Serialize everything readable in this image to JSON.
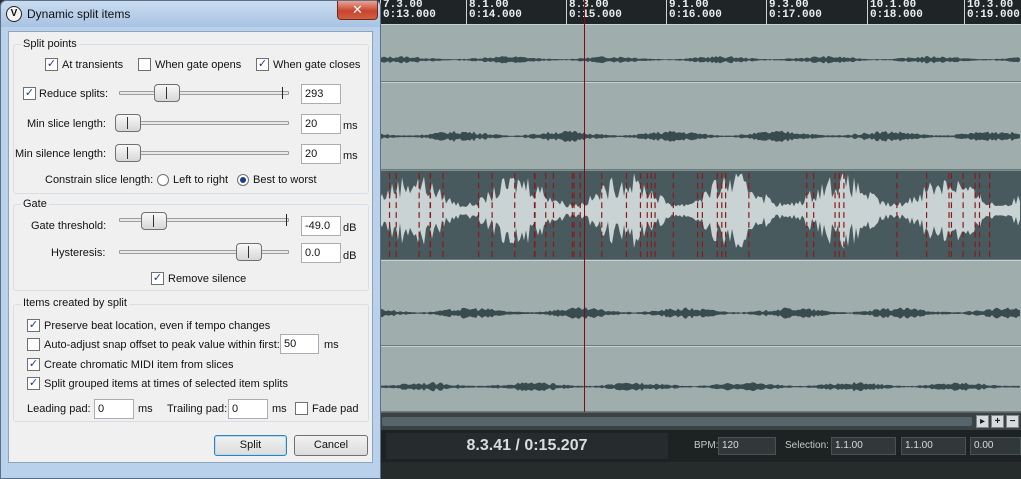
{
  "dialog": {
    "title": "Dynamic split items",
    "close_symbol": "✕",
    "app_icon_symbol": "V",
    "split_points": {
      "group_label": "Split points",
      "at_transients": {
        "label": "At transients",
        "checked": true
      },
      "when_gate_opens": {
        "label": "When gate opens",
        "checked": false
      },
      "when_gate_closes": {
        "label": "When gate closes",
        "checked": true
      },
      "reduce_splits": {
        "label": "Reduce splits:",
        "checked": true,
        "value": "293"
      },
      "min_slice_length": {
        "label": "Min slice length:",
        "value": "20",
        "unit": "ms"
      },
      "min_silence_length": {
        "label": "Min silence length:",
        "value": "20",
        "unit": "ms"
      },
      "constrain": {
        "label": "Constrain slice length:",
        "options": [
          {
            "label": "Left to right",
            "selected": false
          },
          {
            "label": "Best to worst",
            "selected": true
          }
        ]
      }
    },
    "gate": {
      "group_label": "Gate",
      "threshold": {
        "label": "Gate threshold:",
        "value": "-49.0",
        "unit": "dB"
      },
      "hysteresis": {
        "label": "Hysteresis:",
        "value": "0.0",
        "unit": "dB"
      },
      "remove_silence": {
        "label": "Remove silence",
        "checked": true
      }
    },
    "items": {
      "group_label": "Items created by split",
      "preserve_beat": {
        "label": "Preserve beat location, even if tempo changes",
        "checked": true
      },
      "auto_adjust": {
        "label": "Auto-adjust snap offset to peak value within first:",
        "checked": false,
        "value": "50",
        "unit": "ms"
      },
      "create_midi": {
        "label": "Create chromatic MIDI item from slices",
        "checked": true
      },
      "split_grouped": {
        "label": "Split grouped items at times of selected item splits",
        "checked": true
      },
      "leading_pad": {
        "label": "Leading pad:",
        "value": "0",
        "unit": "ms"
      },
      "trailing_pad": {
        "label": "Trailing pad:",
        "value": "0",
        "unit": "ms"
      },
      "fade_pad": {
        "label": "Fade pad",
        "checked": false
      }
    },
    "buttons": {
      "split": "Split",
      "cancel": "Cancel"
    }
  },
  "daw": {
    "ruler": [
      {
        "bar": "7.3.00",
        "time": "0:13.000"
      },
      {
        "bar": "8.1.00",
        "time": "0:14.000"
      },
      {
        "bar": "8.3.00",
        "time": "0:15.000"
      },
      {
        "bar": "9.1.00",
        "time": "0:16.000"
      },
      {
        "bar": "9.3.00",
        "time": "0:17.000"
      },
      {
        "bar": "10.1.00",
        "time": "0:18.000"
      },
      {
        "bar": "10.3.00",
        "time": "0:19.000"
      }
    ],
    "transport": {
      "time_display": "8.3.41 / 0:15.207",
      "bpm_label": "BPM:",
      "bpm_value": "120",
      "selection_label": "Selection:",
      "selection_start": "1.1.00",
      "selection_end": "1.1.00",
      "selection_length": "0.00"
    },
    "zoom_buttons": [
      "▸",
      "+",
      "−"
    ],
    "colors": {
      "track": "#9fadad",
      "selected_track": "#485a5e",
      "waveform": "#3a4b50",
      "split_marker": "#8a1a1a"
    }
  }
}
